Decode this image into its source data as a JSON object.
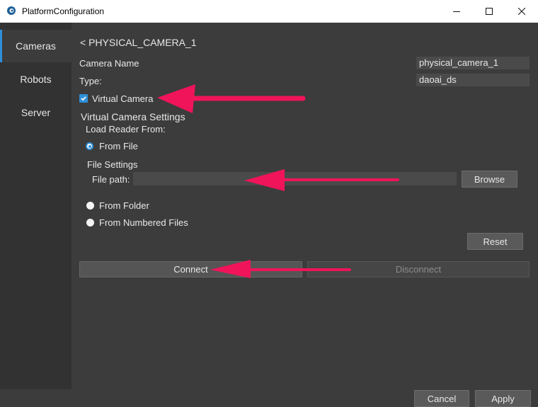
{
  "window": {
    "title": "PlatformConfiguration"
  },
  "sidebar": {
    "items": [
      {
        "label": "Cameras"
      },
      {
        "label": "Robots"
      },
      {
        "label": "Server"
      }
    ]
  },
  "camera": {
    "back_label": "< PHYSICAL_CAMERA_1",
    "name_label": "Camera Name",
    "name_value": "physical_camera_1",
    "type_label": "Type:",
    "type_value": "daoai_ds",
    "virtual_label": "Virtual Camera",
    "virtual_checked": true
  },
  "virtual_settings": {
    "section_title": "Virtual Camera Settings",
    "load_reader_label": "Load Reader From:",
    "from_file_label": "From File",
    "file_settings_label": "File Settings",
    "file_path_label": "File path:",
    "file_path_value": "",
    "browse_label": "Browse",
    "from_folder_label": "From Folder",
    "from_numbered_label": "From Numbered Files",
    "selected_source": "From File",
    "reset_label": "Reset"
  },
  "actions": {
    "connect_label": "Connect",
    "disconnect_label": "Disconnect"
  },
  "footer": {
    "cancel_label": "Cancel",
    "apply_label": "Apply"
  },
  "colors": {
    "accent": "#2f8fd8",
    "annotation_arrow": "#f0145a"
  }
}
